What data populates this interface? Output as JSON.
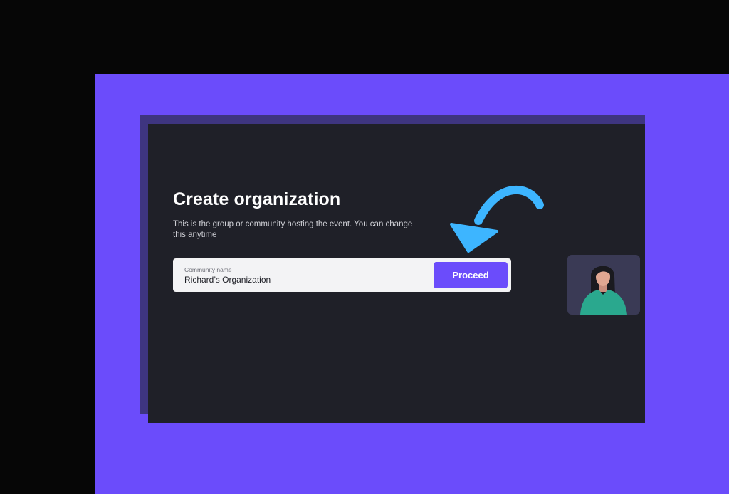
{
  "organization_form": {
    "title": "Create organization",
    "subtitle": "This is the group or community hosting the event. You can change this anytime",
    "community_field": {
      "label": "Community name",
      "value": "Richard’s Organization"
    },
    "proceed_label": "Proceed"
  },
  "colors": {
    "accent": "#6b4cfb",
    "window_background": "#1f2028",
    "arrow": "#3db5ff"
  },
  "icons": {
    "pointer": "curved-arrow-icon",
    "participant": "person-avatar-icon"
  }
}
